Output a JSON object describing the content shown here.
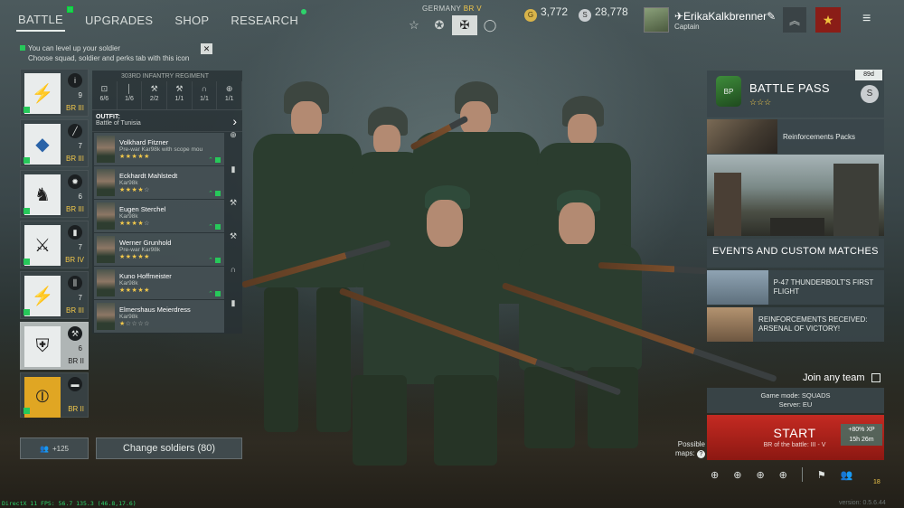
{
  "nav": {
    "tabs": [
      {
        "label": "BATTLE",
        "active": true
      },
      {
        "label": "UPGRADES"
      },
      {
        "label": "SHOP"
      },
      {
        "label": "RESEARCH"
      }
    ]
  },
  "nation": {
    "country": "GERMANY",
    "br": "BR V",
    "buttons": [
      "star-outline-icon",
      "star-badge-icon",
      "iron-cross-icon",
      "circle-icon"
    ]
  },
  "currency": {
    "gold": "3,772",
    "silver": "28,778"
  },
  "profile": {
    "name": "✈ErikaKalkbrenner✎",
    "rank": "Captain"
  },
  "notice": {
    "line1": "You can level up your soldier",
    "line2": "Choose squad, soldier and perks tab with this icon",
    "close": "✕"
  },
  "squads": [
    {
      "count": "9",
      "br": "BR III",
      "type_icon": "info-icon"
    },
    {
      "count": "7",
      "br": "BR III",
      "type_icon": "rifle-icon"
    },
    {
      "count": "6",
      "br": "BR III",
      "type_icon": "flame-icon"
    },
    {
      "count": "7",
      "br": "BR IV",
      "type_icon": "rifle-icon"
    },
    {
      "count": "7",
      "br": "BR III",
      "type_icon": "soldiers-icon"
    },
    {
      "count": "6",
      "br": "BR II",
      "type_icon": "wrench-icon",
      "active": true
    },
    {
      "count": "",
      "br": "BR II",
      "type_icon": "tank-icon"
    }
  ],
  "roster": {
    "regiment": "303RD INFANTRY REGIMENT",
    "stats": [
      {
        "icon": "lock-icon",
        "value": "6/6"
      },
      {
        "icon": "rifle-icon",
        "value": "1/6"
      },
      {
        "icon": "wrench-icon",
        "value": "2/2"
      },
      {
        "icon": "wrench-icon",
        "value": "1/1"
      },
      {
        "icon": "headset-icon",
        "value": "1/1"
      },
      {
        "icon": "crosshair-icon",
        "value": "1/1"
      }
    ],
    "outfit_label": "OUTFIT:",
    "outfit_value": "Battle of Tunisia",
    "soldiers": [
      {
        "name": "Volkhard Fitzner",
        "gun": "Pre-war Kar98k with scope mou",
        "stars": 5,
        "side_icon": "crosshair-icon"
      },
      {
        "name": "Eckhardt Mahlstedt",
        "gun": "Kar98k",
        "stars": 4,
        "side_icon": "bullet-icon"
      },
      {
        "name": "Eugen Sterchel",
        "gun": "Kar98k",
        "stars": 4,
        "side_icon": "wrench-icon"
      },
      {
        "name": "Werner Grunhold",
        "gun": "Pre-war Kar98k",
        "stars": 5,
        "side_icon": "wrench-icon"
      },
      {
        "name": "Kuno Hoffmeister",
        "gun": "Kar98k",
        "stars": 5,
        "side_icon": "headset-icon"
      },
      {
        "name": "Elmershaus Meierdress",
        "gun": "Kar98k",
        "stars": 1,
        "side_icon": "bullet-icon"
      }
    ]
  },
  "bottom_left": {
    "boost_label": "+125",
    "change_label": "Change soldiers (80)"
  },
  "right_panel": {
    "battle_pass": {
      "title": "BATTLE PASS",
      "days": "89d",
      "stars": "☆☆☆"
    },
    "reinforcements_label": "Reinforcements Packs",
    "events_title": "EVENTS AND CUSTOM MATCHES",
    "events": [
      {
        "label": "P-47 THUNDERBOLT'S FIRST FLIGHT"
      },
      {
        "label": "REINFORCEMENTS RECEIVED: ARSENAL OF VICTORY!"
      }
    ],
    "join_label": "Join any team",
    "mode_line1": "Game mode: SQUADS",
    "mode_line2": "Server: EU",
    "start_label": "START",
    "start_br": "BR of the battle: III - V",
    "xp_line1": "+80% XP",
    "xp_line2": "15h 26m",
    "possible_line1": "Possible",
    "possible_line2": "maps:",
    "party_count": "18"
  },
  "debug_text": "DirectX 11 FPS: 56.7 135.3 (46.8,17.6)",
  "version": "version: 0.5.6.44"
}
